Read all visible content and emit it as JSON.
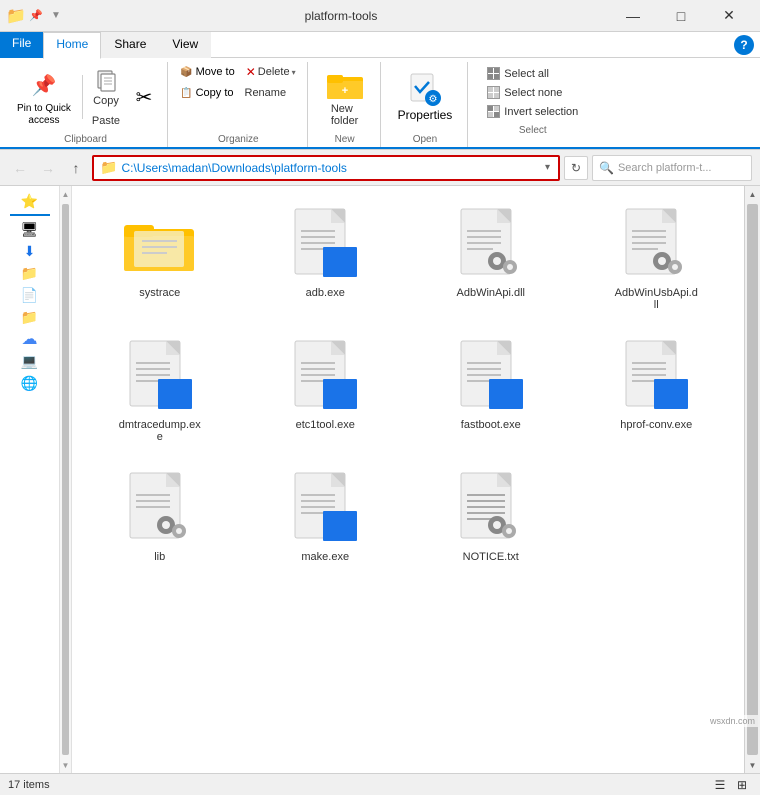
{
  "titleBar": {
    "title": "platform-tools",
    "icons": [
      "yellow",
      "blue",
      "gray"
    ],
    "windowControls": [
      "—",
      "□",
      "✕"
    ]
  },
  "ribbon": {
    "tabs": [
      "File",
      "Home",
      "Share",
      "View"
    ],
    "activeTab": "Home",
    "groups": {
      "clipboard": {
        "label": "Clipboard",
        "pinLabel": "Pin to Quick\naccess",
        "copyLabel": "Copy",
        "pasteLabel": "Paste",
        "cutLabel": "✂"
      },
      "organize": {
        "label": "Organize",
        "moveToLabel": "Move to",
        "copyToLabel": "Copy to",
        "deleteLabel": "Delete",
        "renameLabel": "Rename"
      },
      "new": {
        "label": "New",
        "newFolderLabel": "New\nfolder"
      },
      "open": {
        "label": "Open",
        "propertiesLabel": "Properties"
      },
      "select": {
        "label": "Select",
        "selectAllLabel": "Select all",
        "selectNoneLabel": "Select none",
        "invertLabel": "Invert selection"
      }
    }
  },
  "addressBar": {
    "path": "C:\\Users\\madan\\Downloads\\platform-tools",
    "searchPlaceholder": "Search platform-t..."
  },
  "sidebar": {
    "items": [
      {
        "icon": "⭐",
        "color": "#0078d7",
        "name": "quick-access"
      },
      {
        "icon": "🟦",
        "color": "#0078d7",
        "name": "desktop"
      },
      {
        "icon": "🟦",
        "color": "#1a73e8",
        "name": "downloads"
      },
      {
        "icon": "🟨",
        "color": "#ffc000",
        "name": "folder1"
      },
      {
        "icon": "🟦",
        "color": "#0078d7",
        "name": "documents"
      },
      {
        "icon": "🟨",
        "color": "#ffc000",
        "name": "folder2"
      },
      {
        "icon": "🟦",
        "color": "#4285f4",
        "name": "onedrive"
      },
      {
        "icon": "🟦",
        "color": "#0078d7",
        "name": "this-pc"
      },
      {
        "icon": "🟦",
        "color": "#1a73e8",
        "name": "network"
      }
    ]
  },
  "files": [
    {
      "name": "systrace",
      "type": "folder",
      "icon": "folder"
    },
    {
      "name": "adb.exe",
      "type": "exe",
      "icon": "exe"
    },
    {
      "name": "AdbWinApi.dll",
      "type": "dll",
      "icon": "dll"
    },
    {
      "name": "AdbWinUsbApi.dll",
      "type": "dll2",
      "icon": "dll"
    },
    {
      "name": "dmtracedump.exe",
      "type": "exe",
      "icon": "exe"
    },
    {
      "name": "etc1tool.exe",
      "type": "exe",
      "icon": "exe"
    },
    {
      "name": "fastboot.exe",
      "type": "exe",
      "icon": "exe"
    },
    {
      "name": "hprof-conv.exe",
      "type": "exe",
      "icon": "exe"
    },
    {
      "name": "lib",
      "type": "dll_small",
      "icon": "dll_small"
    },
    {
      "name": "make.exe",
      "type": "exe",
      "icon": "exe"
    },
    {
      "name": "NOTICE.txt",
      "type": "txt",
      "icon": "txt"
    }
  ],
  "statusBar": {
    "itemCount": "17 items"
  },
  "watermark": "wsxdn.com"
}
